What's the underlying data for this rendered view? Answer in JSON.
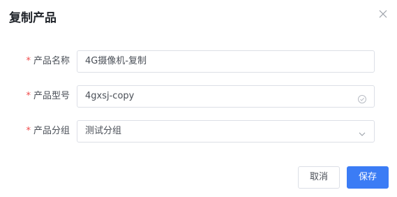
{
  "dialog": {
    "title": "复制产品",
    "close_icon": "close-icon"
  },
  "form": {
    "name": {
      "required_mark": "*",
      "label": "产品名称",
      "value": "4G摄像机-复制"
    },
    "model": {
      "required_mark": "*",
      "label": "产品型号",
      "value": "4gxsj-copy",
      "suffix_icon": "check-circle-icon"
    },
    "group": {
      "required_mark": "*",
      "label": "产品分组",
      "value": "测试分组",
      "suffix_icon": "chevron-down-icon"
    }
  },
  "footer": {
    "cancel_label": "取消",
    "save_label": "保存"
  },
  "colors": {
    "primary": "#3b7cf5",
    "required": "#f04b4b",
    "border": "#dcdfe6"
  }
}
